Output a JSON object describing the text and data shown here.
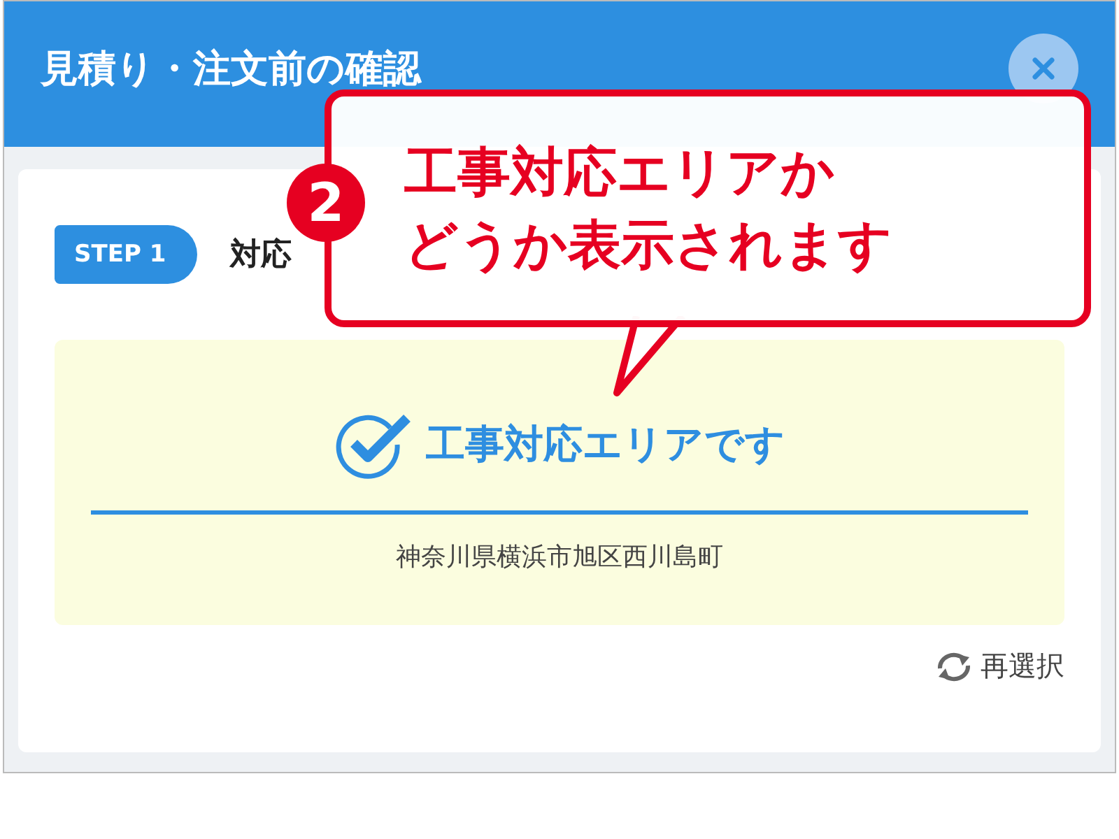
{
  "dialog": {
    "title": "見積り・注文前の確認"
  },
  "step": {
    "badge": "STEP 1",
    "title": "対応"
  },
  "result": {
    "available": true,
    "message": "工事対応エリアです",
    "address": "神奈川県横浜市旭区西川島町"
  },
  "reselect": {
    "label": "再選択"
  },
  "callout": {
    "number": "2",
    "lines": [
      "工事対応エリアか",
      "どうか表示されます"
    ]
  }
}
